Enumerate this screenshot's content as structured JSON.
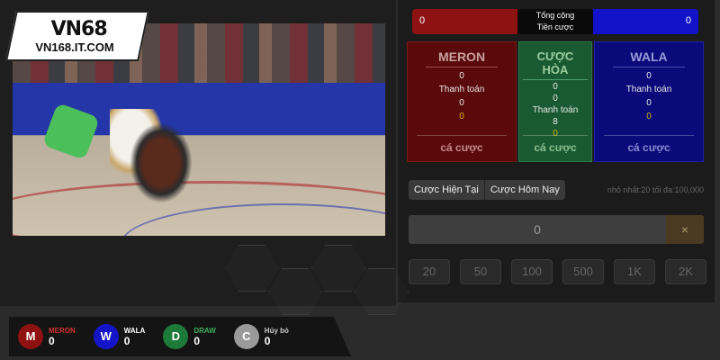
{
  "brand": {
    "logo_top": "VN68",
    "logo_bottom": "VN168.IT.COM"
  },
  "totals": {
    "meron_total": "0",
    "label_line1": "Tổng cộng",
    "label_line2": "Tiền cược",
    "wala_total": "0"
  },
  "boards": {
    "meron": {
      "title": "MERON",
      "v1": "0",
      "payout_label": "Thanh toán",
      "v2": "0",
      "v3": "0",
      "button": "cá cược"
    },
    "draw": {
      "title": "CƯỢC HÒA",
      "v1": "0",
      "v2": "0",
      "payout_label": "Thanh toán",
      "v3": "8",
      "v4": "0",
      "button": "cá cược"
    },
    "wala": {
      "title": "WALA",
      "v1": "0",
      "payout_label": "Thanh toán",
      "v2": "0",
      "v3": "0",
      "button": "cá cược"
    }
  },
  "tabs": {
    "current": "Cược Hiện Tại",
    "today": "Cược Hôm Nay"
  },
  "limits": {
    "text": "nhỏ nhất:20   tối đa:100,000"
  },
  "amount": {
    "value": "0",
    "clear_icon": "×"
  },
  "chips": [
    "20",
    "50",
    "100",
    "500",
    "1K",
    "2K"
  ],
  "stats": [
    {
      "letter": "M",
      "name": "MERON",
      "count": "0",
      "color": "#8e1212",
      "name_color": "#d03030"
    },
    {
      "letter": "W",
      "name": "WALA",
      "count": "0",
      "color": "#1414c8",
      "name_color": "#ffffff"
    },
    {
      "letter": "D",
      "name": "DRAW",
      "count": "0",
      "color": "#1e7a3a",
      "name_color": "#3cb05a"
    },
    {
      "letter": "C",
      "name": "Hủy bỏ",
      "count": "0",
      "color": "#9a9a9a",
      "name_color": "#cccccc"
    }
  ]
}
